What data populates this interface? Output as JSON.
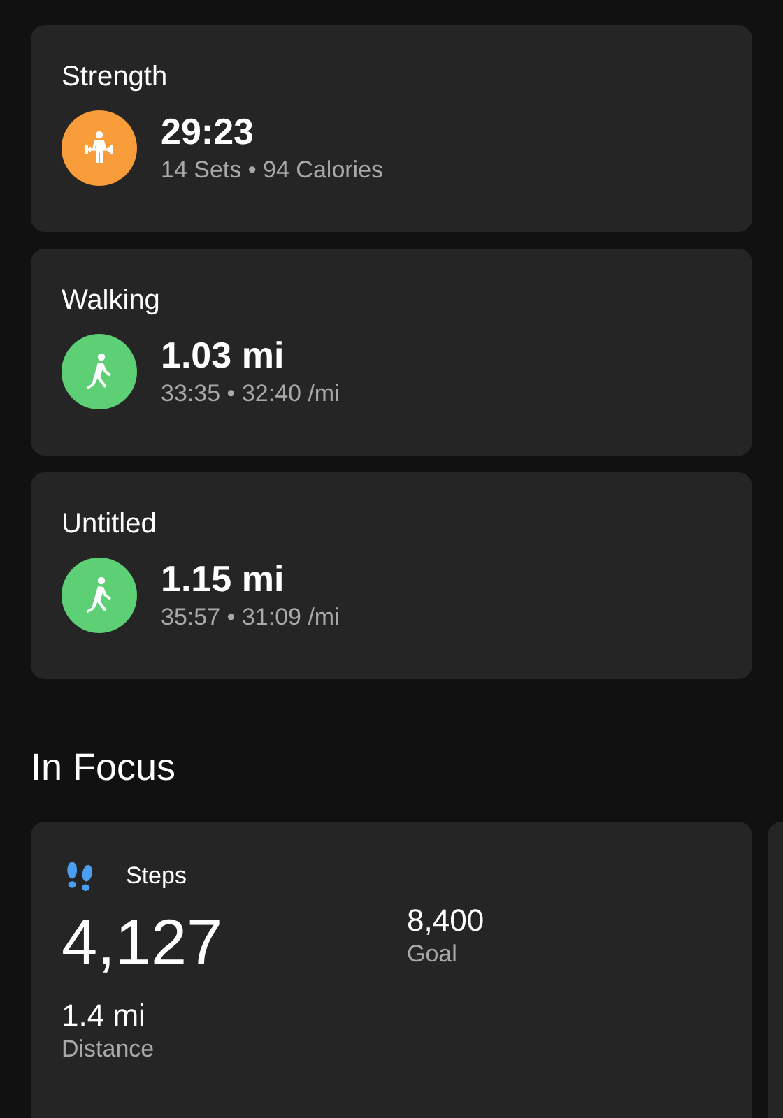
{
  "activities": [
    {
      "kind": "strength",
      "title": "Strength",
      "value": "29:23",
      "details": "14 Sets • 94 Calories"
    },
    {
      "kind": "walking",
      "title": "Walking",
      "value": "1.03 mi",
      "details": "33:35 • 32:40 /mi"
    },
    {
      "kind": "walking",
      "title": "Untitled",
      "value": "1.15 mi",
      "details": "35:57 • 31:09 /mi"
    }
  ],
  "section_title": "In Focus",
  "focus_card": {
    "title": "Steps",
    "value": "4,127",
    "goal_value": "8,400",
    "goal_label": "Goal",
    "distance_value": "1.4 mi",
    "distance_label": "Distance"
  }
}
